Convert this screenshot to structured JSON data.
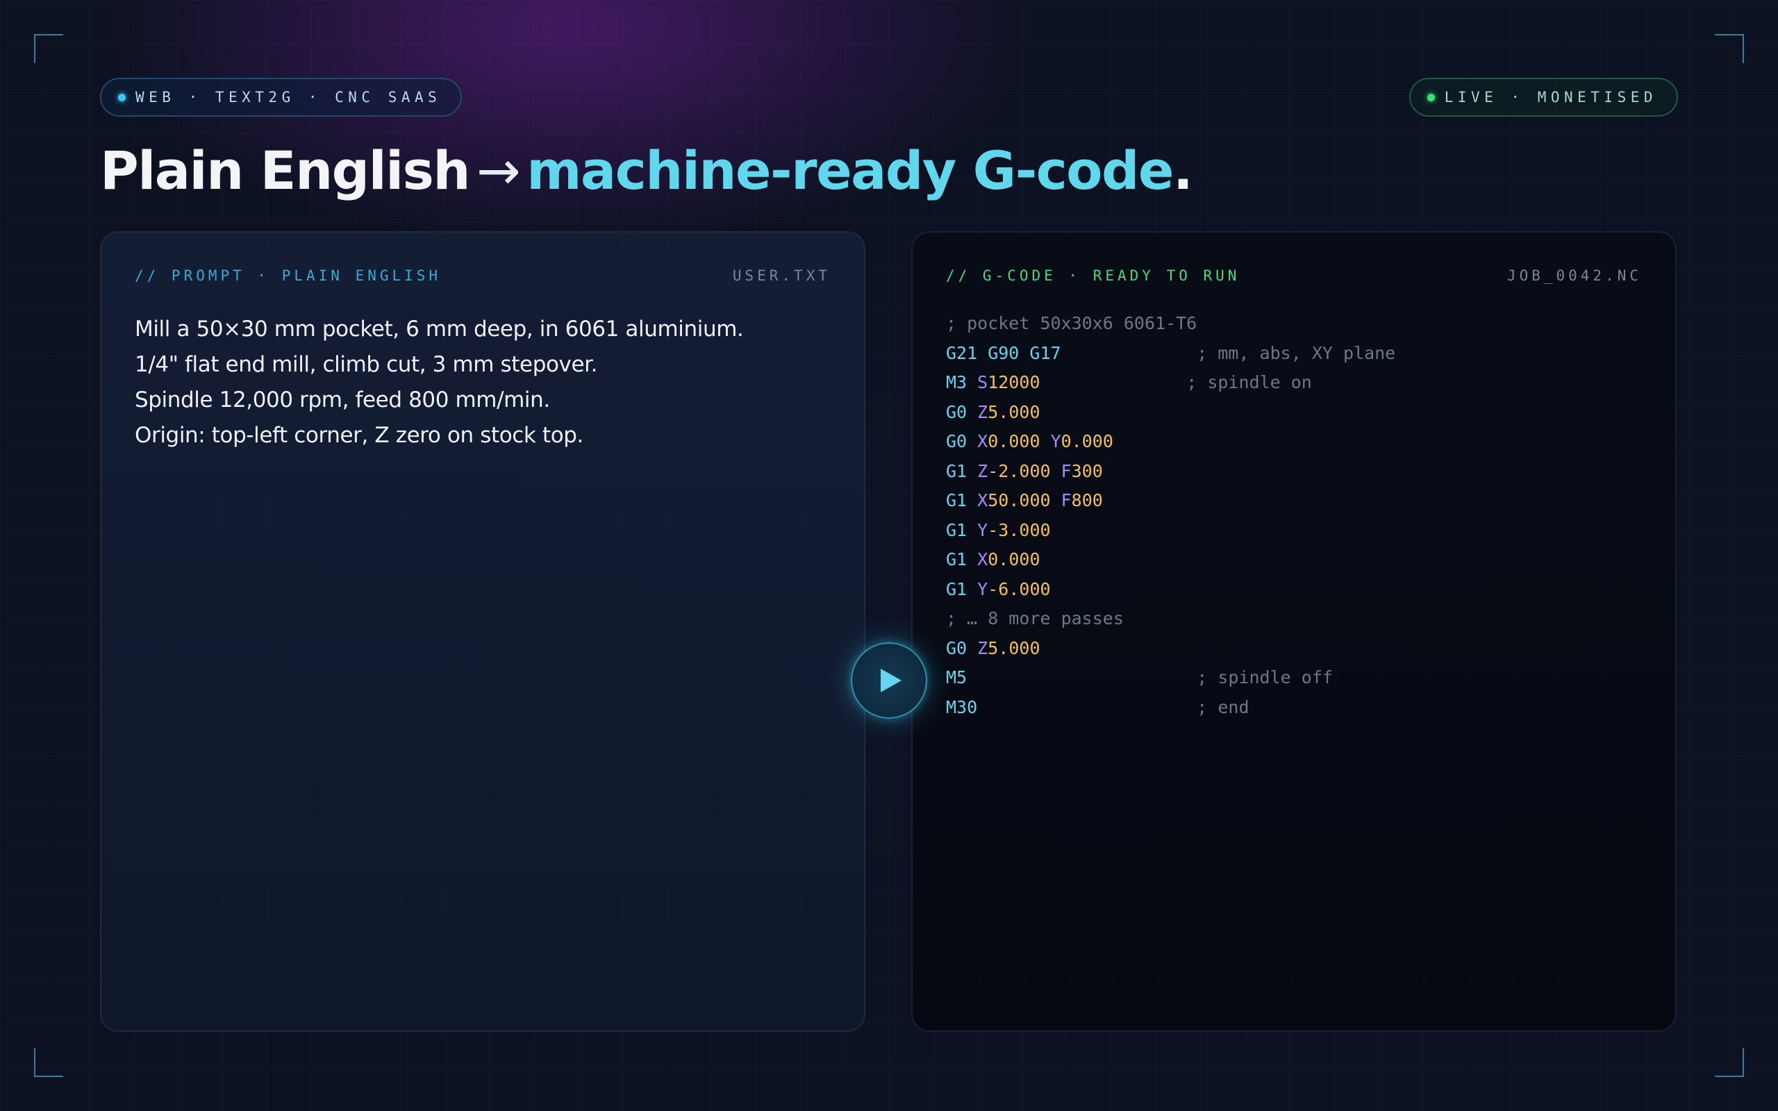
{
  "badges": {
    "left": "WEB · TEXT2G · CNC SAAS",
    "right": "LIVE · MONETISED"
  },
  "headline": {
    "part1": "Plain English",
    "arrow": "→",
    "part2": "machine-ready G-code",
    "period": "."
  },
  "prompt_panel": {
    "title": "// PROMPT · PLAIN ENGLISH",
    "file": "USER.TXT",
    "lines": [
      "Mill a 50×30 mm pocket, 6 mm deep, in 6061 aluminium.",
      "1/4\" flat end mill, climb cut, 3 mm stepover.",
      "Spindle 12,000 rpm, feed 800 mm/min.",
      "Origin: top-left corner, Z zero on stock top."
    ]
  },
  "gcode_panel": {
    "title": "// G-CODE · READY TO RUN",
    "file": "JOB_0042.NC",
    "lines": [
      [
        [
          "cmt",
          "; pocket 50x30x6 6061-T6"
        ]
      ],
      [
        [
          "cmd",
          "G21 G90 G17"
        ],
        [
          "pad",
          "             "
        ],
        [
          "cmt",
          "; mm, abs, XY plane"
        ]
      ],
      [
        [
          "cmd",
          "M3"
        ],
        [
          "pad",
          " "
        ],
        [
          "axis",
          "S"
        ],
        [
          "num",
          "12000"
        ],
        [
          "pad",
          "              "
        ],
        [
          "cmt",
          "; spindle on"
        ]
      ],
      [
        [
          "cmd",
          "G0"
        ],
        [
          "pad",
          " "
        ],
        [
          "axis",
          "Z"
        ],
        [
          "num",
          "5.000"
        ]
      ],
      [
        [
          "cmd",
          "G0"
        ],
        [
          "pad",
          " "
        ],
        [
          "axis",
          "X"
        ],
        [
          "num",
          "0.000"
        ],
        [
          "pad",
          " "
        ],
        [
          "axis",
          "Y"
        ],
        [
          "num",
          "0.000"
        ]
      ],
      [
        [
          "cmd",
          "G1"
        ],
        [
          "pad",
          " "
        ],
        [
          "axis",
          "Z"
        ],
        [
          "num",
          "-2.000"
        ],
        [
          "pad",
          " "
        ],
        [
          "axis",
          "F"
        ],
        [
          "num",
          "300"
        ]
      ],
      [
        [
          "cmd",
          "G1"
        ],
        [
          "pad",
          " "
        ],
        [
          "axis",
          "X"
        ],
        [
          "num",
          "50.000"
        ],
        [
          "pad",
          " "
        ],
        [
          "axis",
          "F"
        ],
        [
          "num",
          "800"
        ]
      ],
      [
        [
          "cmd",
          "G1"
        ],
        [
          "pad",
          " "
        ],
        [
          "axis",
          "Y"
        ],
        [
          "num",
          "-3.000"
        ]
      ],
      [
        [
          "cmd",
          "G1"
        ],
        [
          "pad",
          " "
        ],
        [
          "axis",
          "X"
        ],
        [
          "num",
          "0.000"
        ]
      ],
      [
        [
          "cmd",
          "G1"
        ],
        [
          "pad",
          " "
        ],
        [
          "axis",
          "Y"
        ],
        [
          "num",
          "-6.000"
        ]
      ],
      [
        [
          "cmt",
          "; … 8 more passes"
        ]
      ],
      [
        [
          "cmd",
          "G0"
        ],
        [
          "pad",
          " "
        ],
        [
          "axis",
          "Z"
        ],
        [
          "num",
          "5.000"
        ]
      ],
      [
        [
          "cmd",
          "M5"
        ],
        [
          "pad",
          "                      "
        ],
        [
          "cmt",
          "; spindle off"
        ]
      ],
      [
        [
          "cmd",
          "M30"
        ],
        [
          "pad",
          "                     "
        ],
        [
          "cmt",
          "; end"
        ]
      ]
    ]
  },
  "play_button": {
    "icon": "play-icon",
    "color": "#67d3ee"
  },
  "colors": {
    "accent": "#5fd8ee",
    "live": "#3fe07a",
    "keyword": "#67d3ee",
    "axis": "#a78bfa",
    "number": "#f3c05a",
    "comment": "#6e7788"
  }
}
